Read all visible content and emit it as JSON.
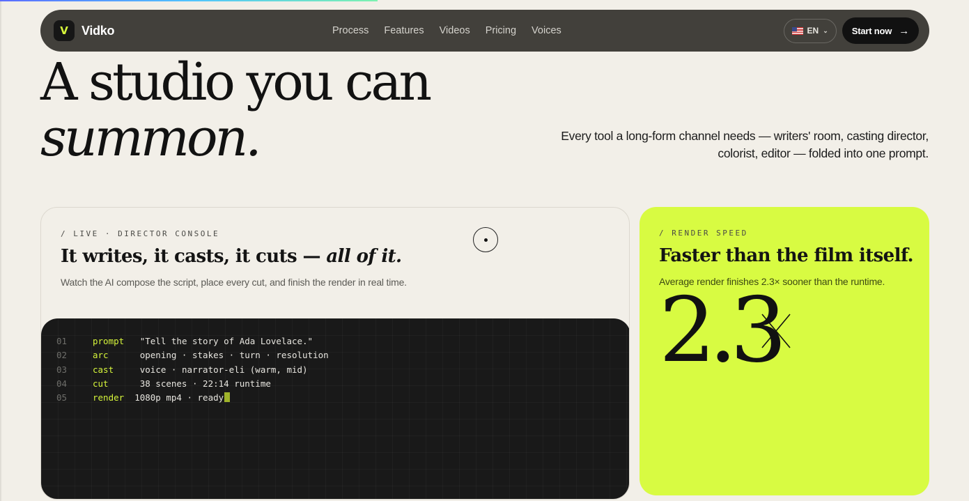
{
  "nav": {
    "brand_initial": "V",
    "brand_name": "Vidko",
    "links": [
      "Process",
      "Features",
      "Videos",
      "Pricing",
      "Voices"
    ],
    "language": "EN",
    "cta_label": "Start now"
  },
  "hero": {
    "title_line1": "A studio you can",
    "title_line2": "summon.",
    "subtitle_line1": "Every tool a long-form channel needs — writers' room, casting director,",
    "subtitle_line2": "colorist, editor — folded into one prompt."
  },
  "console_card": {
    "eyebrow": "/ LIVE · DIRECTOR CONSOLE",
    "title_main": "It writes, it casts, it cuts — ",
    "title_italic": "all of it.",
    "description": "Watch the AI compose the script, place every cut, and finish the render in real time.",
    "lines": [
      {
        "num": "01",
        "key": "prompt",
        "value": "   \"Tell the story of Ada Lovelace.\""
      },
      {
        "num": "02",
        "key": "arc",
        "value": "      opening · stakes · turn · resolution"
      },
      {
        "num": "03",
        "key": "cast",
        "value": "     voice · narrator-eli (warm, mid)"
      },
      {
        "num": "04",
        "key": "cut",
        "value": "      38 scenes · 22:14 runtime"
      },
      {
        "num": "05",
        "key": "render",
        "value": "  1080p mp4 · ready"
      }
    ]
  },
  "speed_card": {
    "eyebrow": "/ RENDER SPEED",
    "title": "Faster than the film itself.",
    "description": "Average render finishes 2.3× sooner than the runtime.",
    "big_value": "2.3"
  },
  "colors": {
    "accent": "#d8fb42",
    "nav_bg": "#3a3834",
    "terminal_bg": "#191919",
    "page_bg": "#f2efe8"
  }
}
